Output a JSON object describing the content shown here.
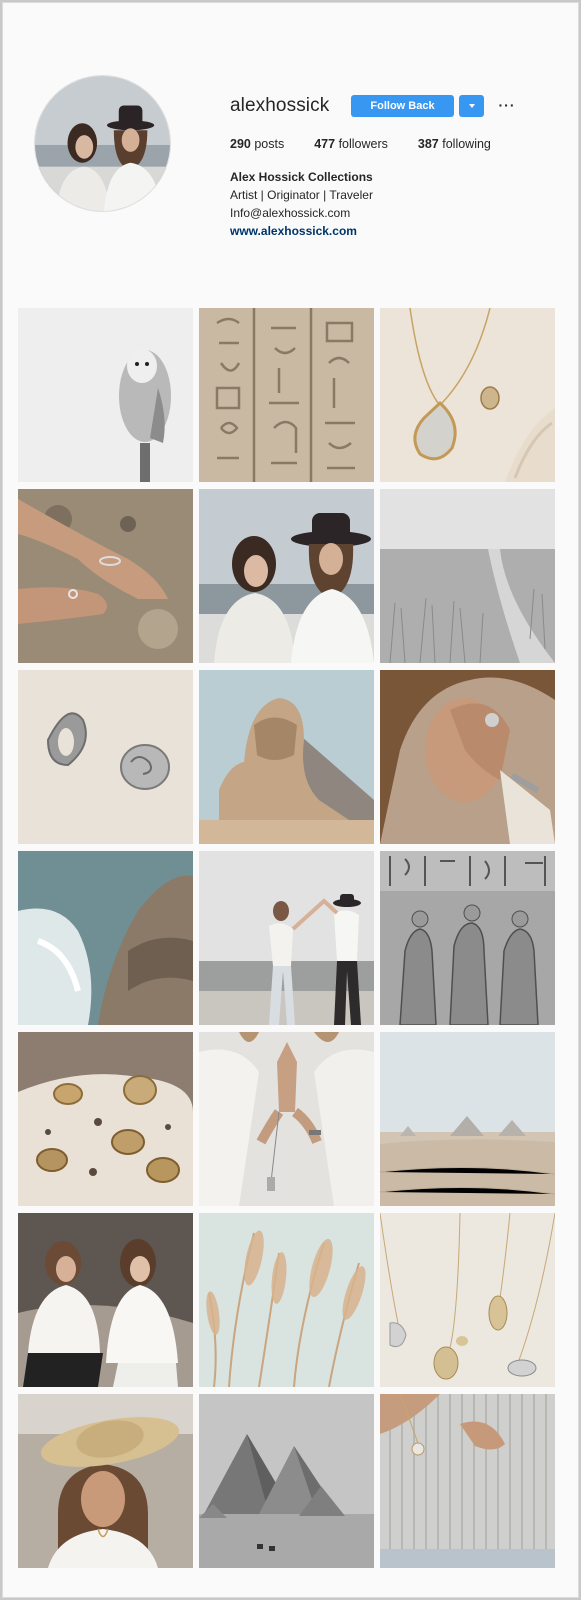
{
  "profile": {
    "username": "alexhossick",
    "follow_label": "Follow Back",
    "more_label": "···",
    "stats": {
      "posts_count": "290",
      "posts_label": "posts",
      "followers_count": "477",
      "followers_label": "followers",
      "following_count": "387",
      "following_label": "following"
    },
    "bio": {
      "name": "Alex Hossick Collections",
      "line1": "Artist | Originator | Traveler",
      "email": "Info@alexhossick.com",
      "website": "www.alexhossick.com"
    }
  },
  "posts": [
    {
      "subject": "barn-owl-on-perch"
    },
    {
      "subject": "egyptian-hieroglyphs"
    },
    {
      "subject": "gold-teardrop-necklace-and-ring"
    },
    {
      "subject": "hands-with-rings-on-rock"
    },
    {
      "subject": "couple-with-hat-by-sea"
    },
    {
      "subject": "grass-field-path"
    },
    {
      "subject": "two-silver-rings"
    },
    {
      "subject": "great-sphinx"
    },
    {
      "subject": "man-covering-eye-with-rings"
    },
    {
      "subject": "waves-crashing-on-rocks"
    },
    {
      "subject": "couple-dancing-on-beach"
    },
    {
      "subject": "hieroglyph-relief-figures"
    },
    {
      "subject": "gold-rings-on-stone"
    },
    {
      "subject": "praying-hands-with-bracelet"
    },
    {
      "subject": "desert-pyramids-distance"
    },
    {
      "subject": "two-women-on-rocks"
    },
    {
      "subject": "pampas-grass"
    },
    {
      "subject": "pendant-necklaces-on-linen"
    },
    {
      "subject": "woman-in-straw-hat"
    },
    {
      "subject": "giza-pyramids-camels"
    },
    {
      "subject": "woman-in-knit-sweater-necklace"
    }
  ]
}
